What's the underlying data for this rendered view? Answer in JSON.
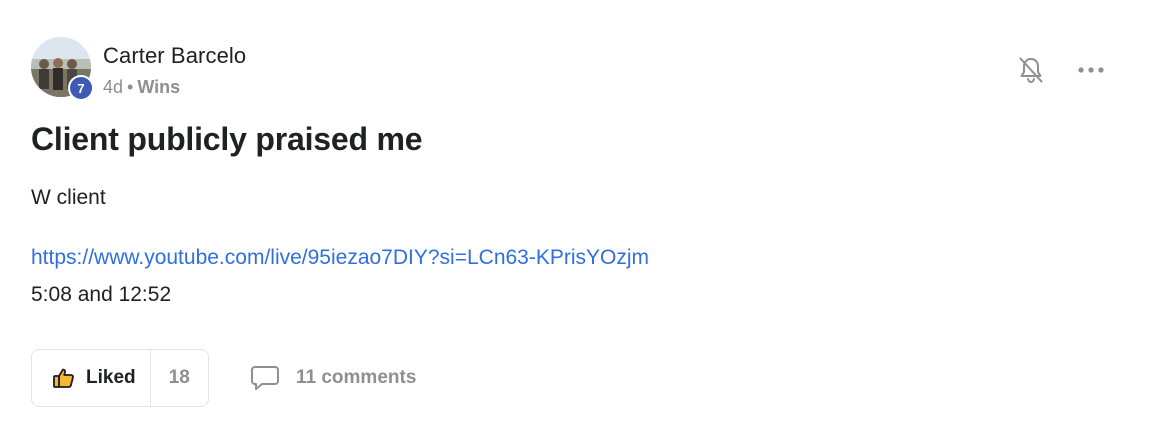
{
  "post": {
    "author": "Carter Barcelo",
    "level": "7",
    "time_ago": "4d",
    "separator": "•",
    "category": "Wins",
    "title": "Client publicly praised me",
    "body": "W client",
    "link": "https://www.youtube.com/live/95iezao7DIY?si=LCn63-KPrisYOzjm",
    "timestamps": "5:08 and 12:52"
  },
  "actions": {
    "like_label": "Liked",
    "like_count": "18",
    "comments_label": "11 comments"
  },
  "icons": {
    "notifications": "bell-off-icon",
    "more": "more-horizontal-icon",
    "like": "thumbs-up-icon",
    "comments": "comment-icon"
  },
  "colors": {
    "badge": "#3d5ab5",
    "link": "#2f6fe0",
    "like_icon": "#f5b82e",
    "muted": "#8e8e93"
  }
}
